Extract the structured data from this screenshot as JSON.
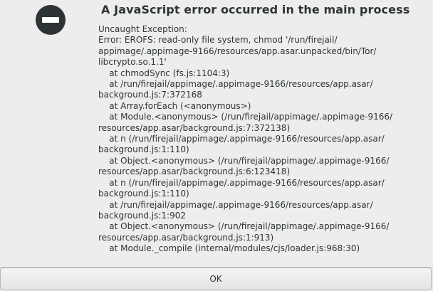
{
  "dialog": {
    "icon": "error-stop-icon",
    "title": "A JavaScript error occurred in the main process",
    "message_lines": [
      "Uncaught Exception:",
      "Error: EROFS: read-only file system, chmod '/run/firejail/",
      "appimage/.appimage-9166/resources/app.asar.unpacked/bin/Tor/",
      "libcrypto.so.1.1'",
      "    at chmodSync (fs.js:1104:3)",
      "    at /run/firejail/appimage/.appimage-9166/resources/app.asar/",
      "background.js:7:372168",
      "    at Array.forEach (<anonymous>)",
      "    at Module.<anonymous> (/run/firejail/appimage/.appimage-9166/",
      "resources/app.asar/background.js:7:372138)",
      "    at n (/run/firejail/appimage/.appimage-9166/resources/app.asar/",
      "background.js:1:110)",
      "    at Object.<anonymous> (/run/firejail/appimage/.appimage-9166/",
      "resources/app.asar/background.js:6:123418)",
      "    at n (/run/firejail/appimage/.appimage-9166/resources/app.asar/",
      "background.js:1:110)",
      "    at /run/firejail/appimage/.appimage-9166/resources/app.asar/",
      "background.js:1:902",
      "    at Object.<anonymous> (/run/firejail/appimage/.appimage-9166/",
      "resources/app.asar/background.js:1:913)",
      "    at Module._compile (internal/modules/cjs/loader.js:968:30)"
    ],
    "ok_label": "OK"
  },
  "colors": {
    "background": "#ededed",
    "icon_fill": "#2e3436",
    "text": "#2e3436"
  }
}
